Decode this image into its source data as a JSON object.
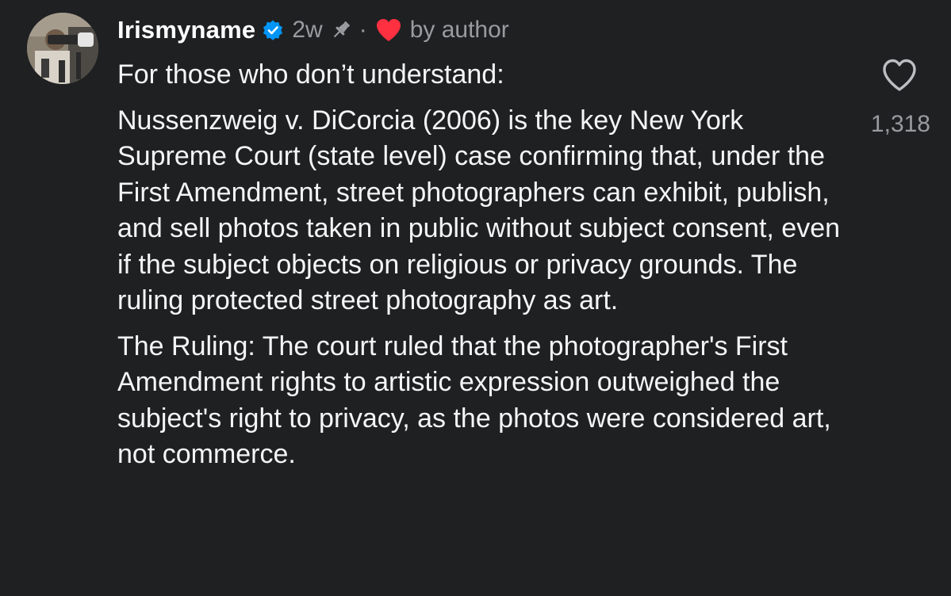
{
  "comment": {
    "username": "Irismyname",
    "age": "2w",
    "separator": "·",
    "by_author": "by author",
    "paragraphs": [
      "For those who don’t understand:",
      "Nussenzweig v. DiCorcia (2006) is the key New York Supreme Court (state level) case confirming that, under the First Amendment, street photographers can exhibit, publish, and sell photos taken in public without subject consent, even if the subject objects on religious or privacy grounds. The ruling protected street photography as art.",
      "The Ruling: The court ruled that the photographer's First Amendment rights to artistic expression outweighed the subject's right to privacy, as the photos were considered art, not commerce."
    ],
    "like_count": "1,318"
  },
  "icons": {
    "verified": "verified-badge-icon",
    "pin": "pin-icon",
    "author_like": "heart-icon",
    "like": "heart-outline-icon"
  },
  "colors": {
    "background": "#1f2022",
    "text": "#f5f5f5",
    "secondary_text": "#9a9b9e",
    "verified_blue": "#0095f6",
    "heart_red": "#ff3040"
  }
}
